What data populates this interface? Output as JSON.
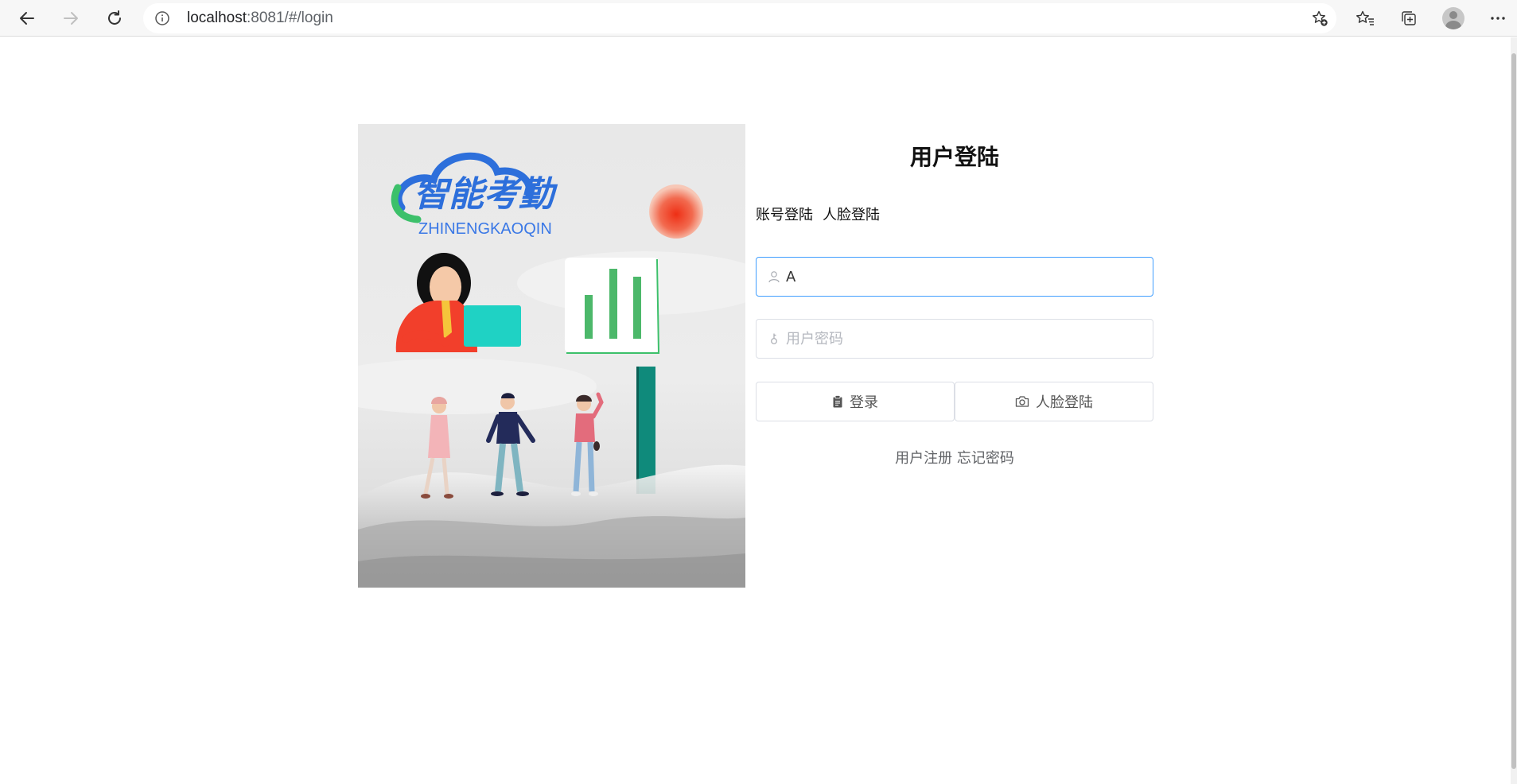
{
  "browser": {
    "url_host": "localhost",
    "url_rest": ":8081/#/login",
    "icons": {
      "back": "arrow-left-icon",
      "forward": "arrow-right-icon",
      "reload": "reload-icon",
      "info": "info-icon",
      "add_favorite": "star-plus-icon",
      "favorites": "favorites-icon",
      "collections": "collections-icon",
      "profile": "avatar",
      "menu": "more-icon"
    }
  },
  "hero": {
    "logo_cn": "智能考勤",
    "logo_en": "ZHINENGKAOQIN"
  },
  "login": {
    "title": "用户登陆",
    "tabs": [
      "账号登陆",
      "人脸登陆"
    ],
    "username": {
      "value": "A",
      "placeholder": ""
    },
    "password": {
      "value": "",
      "placeholder": "用户密码"
    },
    "login_button": "登录",
    "face_button": "人脸登陆",
    "register_link": "用户注册",
    "forgot_link": "忘记密码"
  },
  "colors": {
    "focus_border": "#409eff",
    "logo_blue": "#2d6fdb",
    "logo_green": "#3cc06a"
  }
}
